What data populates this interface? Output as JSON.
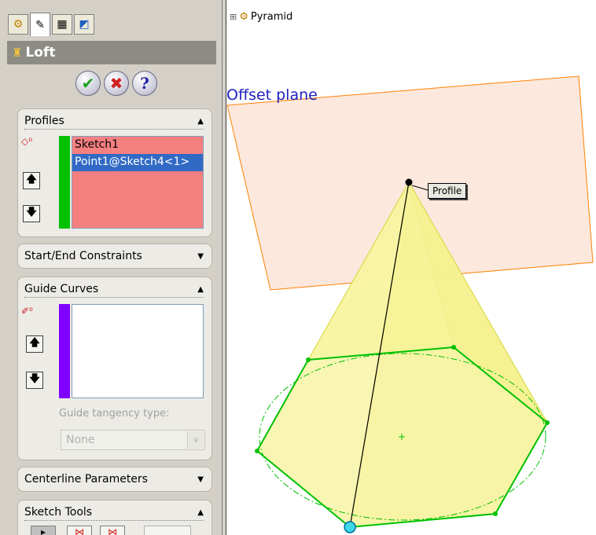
{
  "tabs": [
    {
      "icon": "feature-manager-icon",
      "glyph": "⚙"
    },
    {
      "icon": "property-manager-icon",
      "glyph": "✎"
    },
    {
      "icon": "configuration-manager-icon",
      "glyph": "▦"
    },
    {
      "icon": "appearance-icon",
      "glyph": "◩"
    }
  ],
  "title": "Loft",
  "buttons": {
    "ok": "✔",
    "cancel": "✖",
    "help": "?"
  },
  "profiles": {
    "header": "Profiles",
    "items": [
      "Sketch1",
      "Point1@Sketch4<1>"
    ],
    "selected_index": 1
  },
  "start_end": {
    "header": "Start/End Constraints"
  },
  "guide_curves": {
    "header": "Guide Curves",
    "tangency_label": "Guide tangency type:",
    "tangency_value": "None"
  },
  "centerline": {
    "header": "Centerline Parameters"
  },
  "sketch_tools": {
    "header": "Sketch Tools"
  },
  "tree": {
    "root_label": "Pyramid",
    "expander": "⊞"
  },
  "viewport": {
    "plane_label": "Offset plane",
    "callout_label": "Profile"
  },
  "colors": {
    "profiles_bar": "#00c000",
    "guide_bar": "#8000ff",
    "list_bg": "#f58080",
    "selection": "#316ac5",
    "plane_fill": "#fbe4d6",
    "plane_edge": "#ff8000",
    "pyramid_fill": "#f8f8a0",
    "sketch_green": "#00c000"
  }
}
